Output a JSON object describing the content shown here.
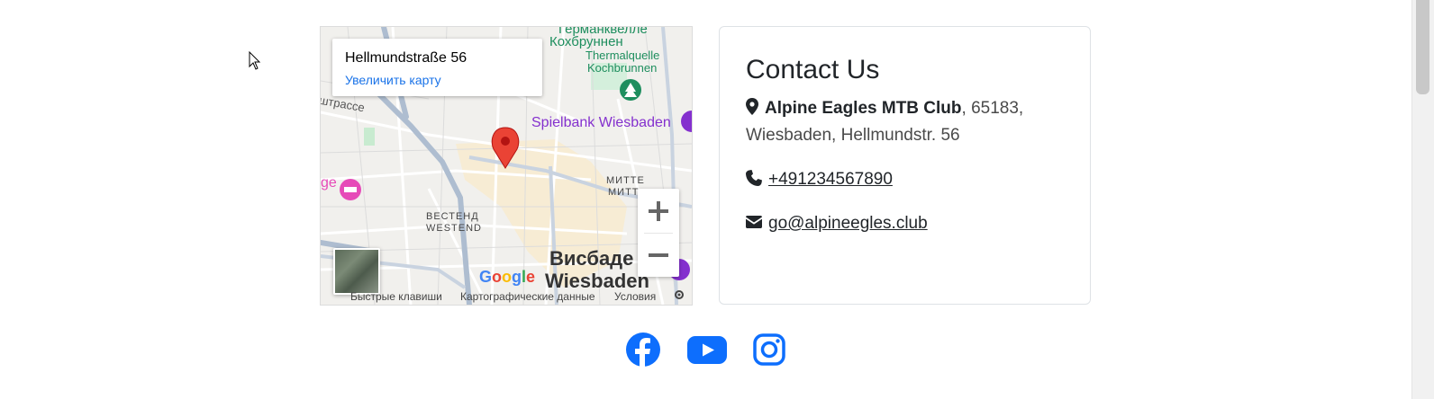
{
  "map": {
    "place_address": "Hellmundstraße 56",
    "place_link": "Увеличить карту",
    "labels": {
      "germ": "Германквелле",
      "kochbrunnen_ru": "Кохбруннен",
      "thermalquelle": "Thermalquelle",
      "kochbrunnen": "Kochbrunnen",
      "strasse_ru": "штрассе",
      "spielbank": "Spielbank Wiesbaden",
      "mitte_ru": "МИТТЕ",
      "mitte": "МИТТ",
      "westend_ru": "ВЕСТЕНД",
      "westend": "WESTEND",
      "ge": "ge",
      "city_ru": "Висбаде",
      "city": "Wiesbaden"
    },
    "zoom_in": "+",
    "zoom_out": "−",
    "google_logo": "Google",
    "attribution": {
      "shortcuts": "Быстрые клавиши",
      "map_data": "Картографические данные",
      "terms": "Условия"
    }
  },
  "contact": {
    "title": "Contact Us",
    "club_name": "Alpine Eagles MTB Club",
    "address_tail": ", 65183,",
    "address_line2": "Wiesbaden, Hellmundstr. 56",
    "phone": "+491234567890",
    "email": "go@alpineegles.club"
  },
  "colors": {
    "social_blue": "#0d6efd",
    "marker_red": "#ea4335",
    "link_blue": "#1a73e8",
    "poi_purple": "#8430ce",
    "poi_pink": "#e64ab8",
    "poi_green": "#1e8e5e"
  },
  "socials": [
    {
      "icon": "facebook-icon"
    },
    {
      "icon": "youtube-icon"
    },
    {
      "icon": "instagram-icon"
    }
  ]
}
